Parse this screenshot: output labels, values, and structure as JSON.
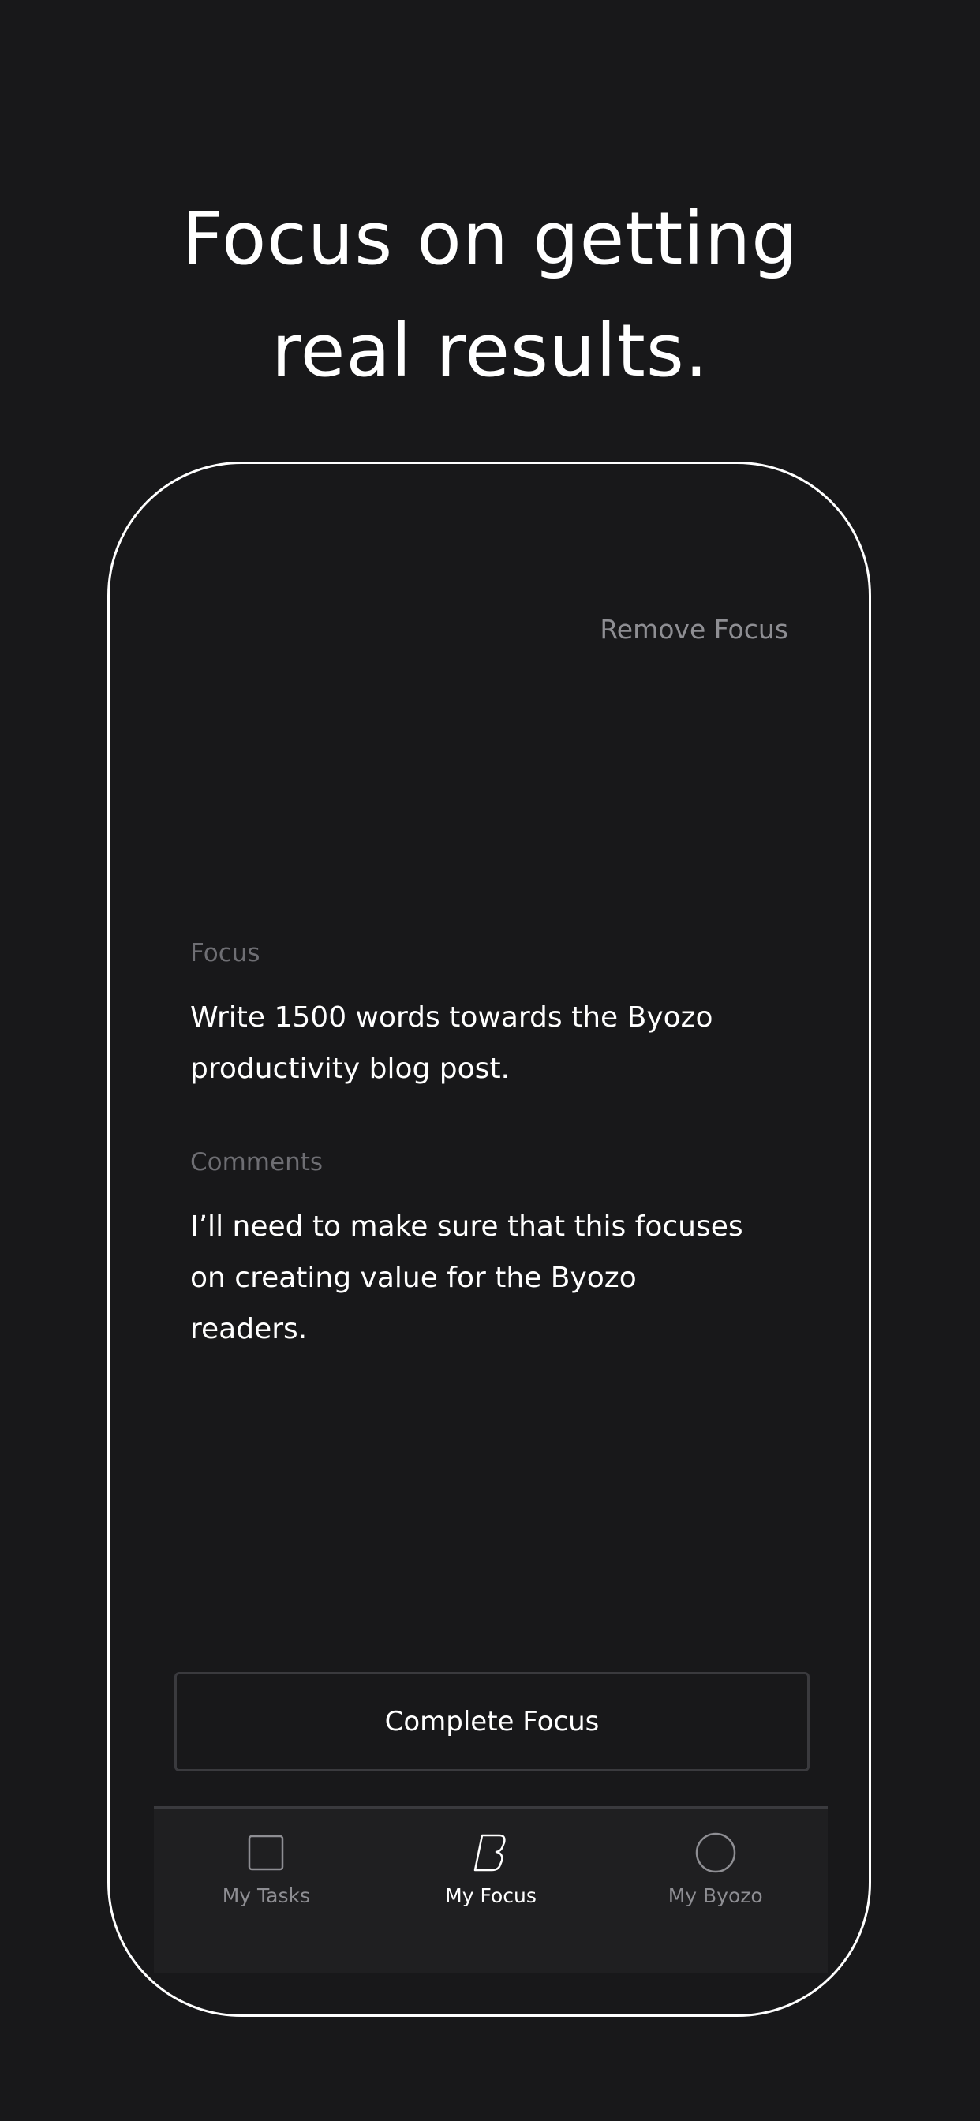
{
  "headline": {
    "line1": "Focus on getting",
    "line2": "real results."
  },
  "screen": {
    "remove_focus": "Remove Focus",
    "focus_label": "Focus",
    "focus_text": "Write 1500 words towards the Byozo productivity blog post.",
    "comments_label": "Comments",
    "comments_text": "I’ll need to make sure that this focuses on creating value for the Byozo readers.",
    "complete_button": "Complete Focus"
  },
  "tabbar": {
    "items": [
      {
        "label": "My Tasks",
        "icon": "square-icon",
        "active": false
      },
      {
        "label": "My Focus",
        "icon": "byozo-b-icon",
        "active": true
      },
      {
        "label": "My Byozo",
        "icon": "circle-icon",
        "active": false
      }
    ]
  },
  "colors": {
    "background": "#18181a",
    "text_primary": "#ffffff",
    "text_secondary": "#8e8e93",
    "text_muted": "#6e6e73",
    "border": "#3a3a3e",
    "tabbar_bg": "#1f1f21"
  }
}
